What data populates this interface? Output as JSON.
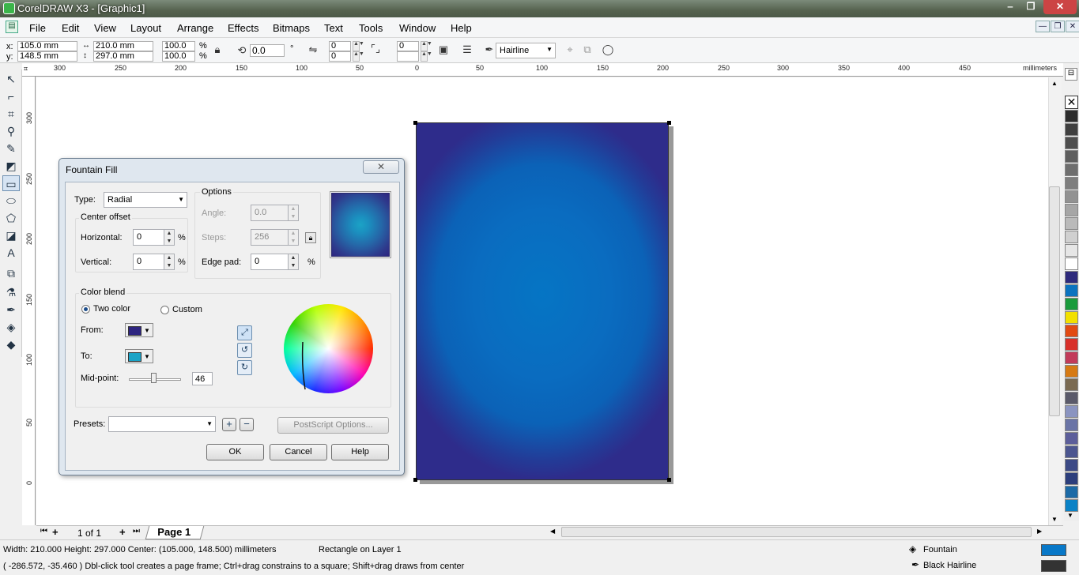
{
  "window": {
    "title": "CorelDRAW X3 - [Graphic1]",
    "minimize": "‒",
    "restore": "❐",
    "close": "✕"
  },
  "menu": [
    "File",
    "Edit",
    "View",
    "Layout",
    "Arrange",
    "Effects",
    "Bitmaps",
    "Text",
    "Tools",
    "Window",
    "Help"
  ],
  "docctrl": {
    "min": "—",
    "restore": "❐",
    "close": "✕"
  },
  "propbar": {
    "x_label": "x:",
    "x": "105.0 mm",
    "y_label": "y:",
    "y": "148.5 mm",
    "w": "210.0 mm",
    "h": "297.0 mm",
    "sx": "100.0",
    "sy": "100.0",
    "pct1": "%",
    "pct2": "%",
    "rot": "0.0",
    "deg": "°",
    "c1": "0",
    "c2": "0",
    "c3": "0",
    "outline": "Hairline"
  },
  "ruler": {
    "hticks": [
      "300",
      "250",
      "200",
      "150",
      "100",
      "50",
      "0",
      "50",
      "100",
      "150",
      "200",
      "250",
      "300",
      "350",
      "400",
      "450"
    ],
    "unit": "millimeters",
    "vticks": [
      "300",
      "250",
      "200",
      "150",
      "100",
      "50",
      "0"
    ],
    "vunit": "millimeters"
  },
  "pagebar": {
    "count": "1 of 1",
    "tab": "Page 1"
  },
  "status": {
    "line1": "Width: 210.000  Height: 297.000  Center: (105.000, 148.500)  millimeters",
    "layer": "Rectangle on Layer 1",
    "line2": "( -286.572, -35.460 )   Dbl-click tool creates a page frame; Ctrl+drag constrains to a square; Shift+drag draws from center",
    "fill": "Fountain",
    "outline": "Black  Hairline",
    "fill_color": "#0878c8",
    "outline_color": "#333333"
  },
  "dialog": {
    "title": "Fountain Fill",
    "close": "✕",
    "type_label": "Type:",
    "type": "Radial",
    "center_offset": "Center offset",
    "horizontal_label": "Horizontal:",
    "horizontal": "0",
    "vertical_label": "Vertical:",
    "vertical": "0",
    "pct": "%",
    "options": "Options",
    "angle_label": "Angle:",
    "angle": "0.0",
    "steps_label": "Steps:",
    "steps": "256",
    "edgepad_label": "Edge pad:",
    "edgepad": "0",
    "color_blend": "Color blend",
    "two_color": "Two color",
    "custom": "Custom",
    "from_label": "From:",
    "to_label": "To:",
    "from_color": "#2e2580",
    "to_color": "#1ba3c6",
    "midpoint_label": "Mid-point:",
    "midpoint": "46",
    "presets_label": "Presets:",
    "presets": "",
    "add_preset": "+",
    "remove_preset": "−",
    "postscript": "PostScript Options...",
    "ok": "OK",
    "cancel": "Cancel",
    "help": "Help"
  },
  "palette": [
    "#2c2c2c",
    "#3f3f3f",
    "#4e4e4e",
    "#5e5e5e",
    "#6e6e6e",
    "#7e7e7e",
    "#929292",
    "#a6a6a6",
    "#bababa",
    "#d0d0d0",
    "#e6e6e6",
    "#ffffff",
    "#2e2a7c",
    "#0b73bf",
    "#1a9b3c",
    "#f2e000",
    "#e24a12",
    "#d8302a",
    "#c23b5a",
    "#d67a14",
    "#7a6a52",
    "#5a5a6a",
    "#8a94c0",
    "#6a74a6",
    "#5c5e9a",
    "#4c5690",
    "#3c4a86",
    "#2c3e7c",
    "#1c6aa6",
    "#0a82c6"
  ]
}
